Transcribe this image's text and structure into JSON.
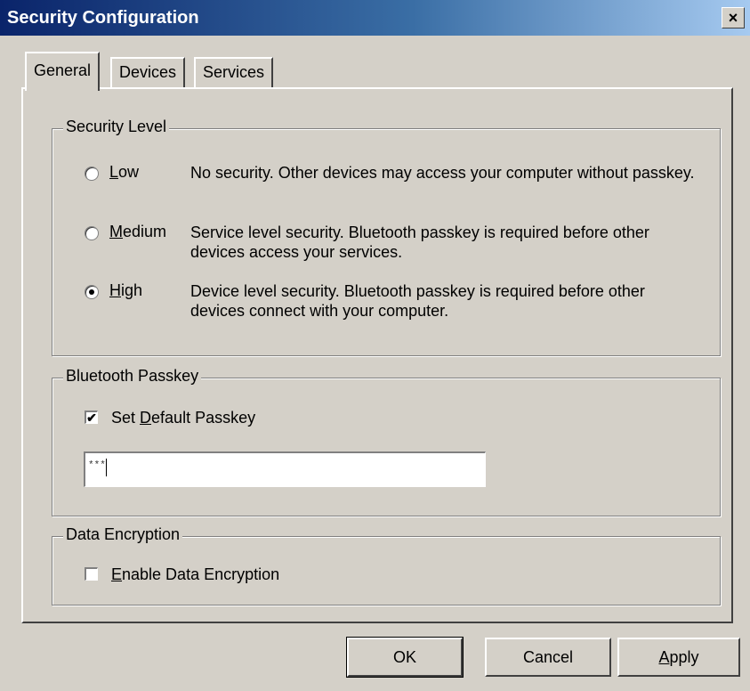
{
  "window": {
    "title": "Security Configuration",
    "close_label": "×"
  },
  "tabs": [
    {
      "label": "General",
      "active": true
    },
    {
      "label": "Devices",
      "active": false
    },
    {
      "label": "Services",
      "active": false
    }
  ],
  "security_level": {
    "legend": "Security Level",
    "selected": "High",
    "options": [
      {
        "accel": "L",
        "label_rest": "ow",
        "description": "No security. Other devices may access your computer without passkey."
      },
      {
        "accel": "M",
        "label_rest": "edium",
        "description": "Service level security. Bluetooth passkey is required before other devices access your services."
      },
      {
        "accel": "H",
        "label_rest": "igh",
        "description": "Device level security. Bluetooth passkey is required before other devices connect with your computer."
      }
    ]
  },
  "bluetooth_passkey": {
    "legend": "Bluetooth Passkey",
    "checkbox_label_pre": "Set ",
    "checkbox_accel": "D",
    "checkbox_label_post": "efault Passkey",
    "checked": true,
    "passkey_value": "***"
  },
  "data_encryption": {
    "legend": "Data Encryption",
    "checkbox_accel": "E",
    "checkbox_label_post": "nable Data Encryption",
    "checked": false
  },
  "buttons": {
    "ok": "OK",
    "cancel": "Cancel",
    "apply_accel": "A",
    "apply_rest": "pply"
  }
}
